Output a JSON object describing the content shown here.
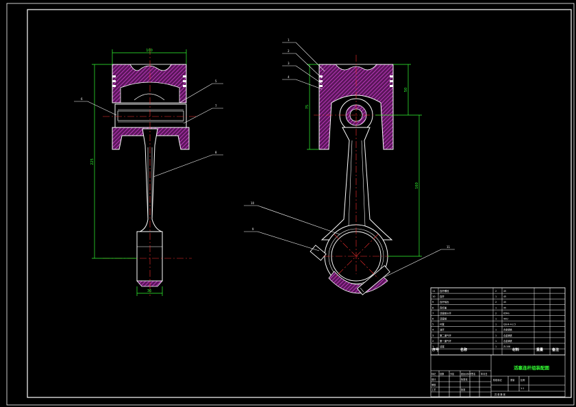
{
  "drawing": {
    "title": "活塞连杆组装配图",
    "colors": {
      "background": "#000000",
      "line": "#ffffff",
      "hatch": "#c030c0",
      "dimension": "#33ff33",
      "center": "#ff3030",
      "leader": "#ffffff"
    },
    "dimensions": {
      "left_piston_width": "100",
      "left_total_height": "225",
      "left_bigend_width": "36",
      "right_piston_height": "75",
      "right_piston_pin_offset": "50",
      "right_center_distance": "160"
    },
    "balloons_left": [
      "6",
      "5",
      "7",
      "8"
    ],
    "balloons_right": [
      "1",
      "2",
      "3",
      "4",
      "10",
      "9",
      "11"
    ],
    "bom": {
      "rows": [
        {
          "no": "11",
          "name": "连杆螺栓",
          "qty": "2",
          "material": "45"
        },
        {
          "no": "10",
          "name": "连杆",
          "qty": "1",
          "material": "45"
        },
        {
          "no": "9",
          "name": "连杆轴瓦",
          "qty": "2",
          "material": "45"
        },
        {
          "no": "8",
          "name": "连杆盖",
          "qty": "1",
          "material": "45"
        },
        {
          "no": "7",
          "name": "活塞销卡环",
          "qty": "2",
          "material": "65Mn"
        },
        {
          "no": "6",
          "name": "活塞销",
          "qty": "1",
          "material": "40Cr"
        },
        {
          "no": "5",
          "name": "衬套",
          "qty": "1",
          "material": "QSn4-4-2.5"
        },
        {
          "no": "4",
          "name": "油环",
          "qty": "1",
          "material": "合金铸铁"
        },
        {
          "no": "3",
          "name": "第二道气环",
          "qty": "1",
          "material": "合金铸铁"
        },
        {
          "no": "2",
          "name": "第一道气环",
          "qty": "1",
          "material": "合金铸铁"
        },
        {
          "no": "1",
          "name": "活塞",
          "qty": "1",
          "material": "ZL108"
        }
      ],
      "header": {
        "no": "序号",
        "name": "名称",
        "qty": "数量",
        "material": "材料",
        "mass": "重量",
        "note": "备注"
      }
    },
    "title_block": {
      "title": "活塞连杆组装配图",
      "rows": [
        "标记",
        "处数",
        "分区",
        "更改文件号",
        "签名",
        "年月日"
      ],
      "design": "设计",
      "check": "审核",
      "process": "工艺",
      "approve": "批准",
      "standard": "标准化",
      "stage": "阶段标记",
      "weight": "重量",
      "scale": "比例",
      "scale_value": "1:1",
      "sheet": "共 张 第 张"
    }
  }
}
